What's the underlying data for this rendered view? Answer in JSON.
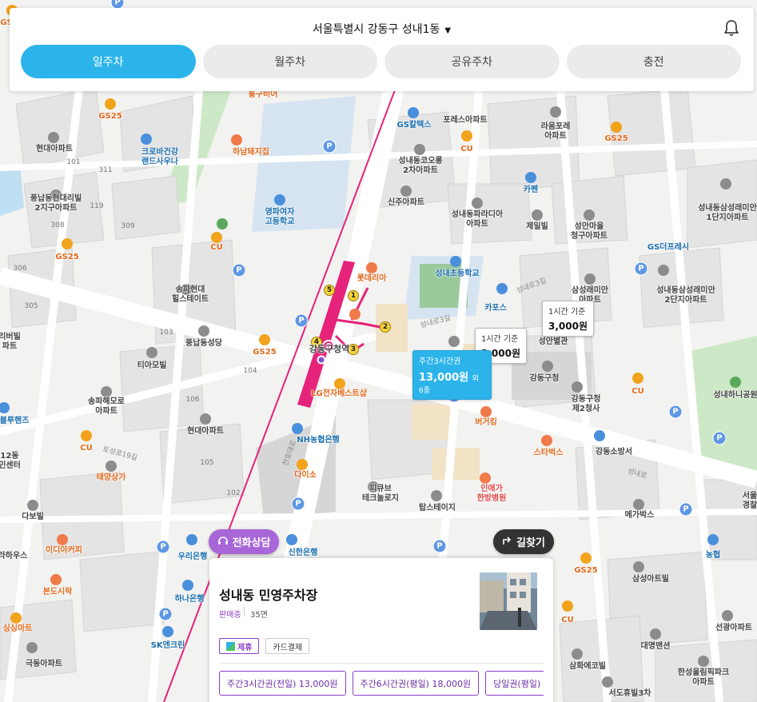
{
  "header": {
    "location": "서울특별시 강동구 성내1동",
    "location_caret": "▼"
  },
  "tabs": [
    {
      "label": "일주차",
      "active": true
    },
    {
      "label": "월주차",
      "active": false
    },
    {
      "label": "공유주차",
      "active": false
    },
    {
      "label": "충전",
      "active": false
    }
  ],
  "map": {
    "labels": {
      "jungguhvir": "퉁구비어",
      "gs25_1": "GS25",
      "gs25_2": "GS25",
      "gs25_3": "GS25",
      "gs25_4": "GS25",
      "gs25_5": "GS25",
      "gs_caltex": "GS칼텍스",
      "forest_apt": "포레스아파트",
      "laumforet": "라움포레\n아파트",
      "hyundai_apt1": "현대아파트",
      "crobagangang": "크로바건강\n랜드사우나",
      "hanam_pig": "하남돼지집",
      "cu1": "CU",
      "cu2": "CU",
      "cu3": "CU",
      "cu4": "CU",
      "cu5": "CU",
      "sungnae_kolon": "성내동코오롱\n2차아파트",
      "capen": "카펜",
      "pungnap_daerim": "풍납동현대리빌\n2지구아파트",
      "youngpa_girls": "영파여자\n고등학교",
      "sinju_apt": "신주아파트",
      "sungnae_paradia": "성내동파라디아\n아파트",
      "jeil_villa": "제일빌",
      "sungan_village": "성안마을\n청구아파트",
      "gs_fresh": "GS더프레시",
      "sungnae_samsung": "성내동삼성래미안\n1단지아파트",
      "lotteria": "롯데리아",
      "sungnae_elem": "성내초등학교",
      "songpa_hyundai": "송파현대\n힐스테이트",
      "samsung_raemian2": "삼성래미안\n아파트",
      "sungnae_raemian2": "성내동삼성래미안\n2단지아파트",
      "capos": "카포스",
      "pungnap_church": "풍납동성당",
      "gs25_pungnap": "GS25",
      "gangdong_station": "강동구청역",
      "gangdong_office": "강동구청",
      "sungan_hall": "성안별관",
      "tiamovil": "티아모빌",
      "lg_best": "LG전자베스트샵",
      "burger_king": "버거킹",
      "gangdong_office2": "강동구청\n제2청사",
      "songpa_maeul": "송파해모로\n아파트",
      "hyundai_apt2": "현대아파트",
      "nh_bank": "NH농협은행",
      "starbucks": "스타벅스",
      "gangdong_fire": "강동소방서",
      "sungnae_hanish": "성내하니공원",
      "blue_hands": "블루핸즈",
      "taeyang": "태양상가",
      "daiso": "다이소",
      "pickyub": "피큐브\n테크놀로지",
      "tapsteizi": "탑스테이지",
      "inaega": "인애가\n한방병원",
      "megabox": "메가박스",
      "dabil": "다보빌",
      "idiya": "이디야커피",
      "woori_bank": "우리은행",
      "shinhan_bank": "신한은행",
      "nonghyup": "농협",
      "samsung_art": "삼성아트빌",
      "bondo": "본도시락",
      "hana_bank": "하나은행",
      "sk_enclean": "SK엔크린",
      "daemyung": "대명맨션",
      "hankang_olympic": "한성올림픽파크\n아파트",
      "ssangsung": "싱싱마트",
      "keukdong": "극동아파트",
      "samhwa": "삼화에코빌",
      "seodong": "서도휴빌3차",
      "seon_apt": "선광아파트",
      "rahouse": "라하우스",
      "dabil_seoul": "서울\n경찰",
      "gungdong_apt": "12동\n민센터",
      "sangang_villa": "리버빌\n파트"
    },
    "road_labels": {
      "r1": "토성로19길",
      "r2": "성내로3길",
      "r3": "성내로3길",
      "r4": "성내로",
      "r5": "천호대로",
      "r6": "성내로"
    },
    "numbers": {
      "n101a": "101",
      "n311": "311",
      "n119": "119",
      "n308": "308",
      "n309": "309",
      "n306": "306",
      "n305": "305",
      "n103": "103",
      "n104": "104",
      "n106": "106",
      "n105": "105",
      "n102": "102"
    },
    "subway": {
      "line": "8"
    },
    "exits": [
      "1",
      "2",
      "3",
      "4",
      "5"
    ],
    "price_tags": [
      {
        "top": "1시간 기준",
        "value": "3,000원"
      },
      {
        "top": "1시간 기준",
        "value": "3,000원"
      },
      {
        "top": "주간3시간권",
        "value": "13,000원",
        "more": "외 6종"
      }
    ],
    "parking_marker": "P"
  },
  "buttons": {
    "consult": "전화상담",
    "route": "길찾기"
  },
  "card": {
    "title": "성내동 민영주차장",
    "status": "판매중",
    "spaces": "35면",
    "badges": [
      {
        "label": "제휴",
        "type": "partner"
      },
      {
        "label": "카드결제",
        "type": "normal"
      }
    ],
    "tickets": [
      "주간3시간권(전일) 13,000원",
      "주간6시간권(평일) 18,000원",
      "당일권(평일) 2"
    ]
  },
  "colors": {
    "accent": "#2cb4ea",
    "purple": "#8a3fc7",
    "subway_line8": "#e6237a"
  }
}
